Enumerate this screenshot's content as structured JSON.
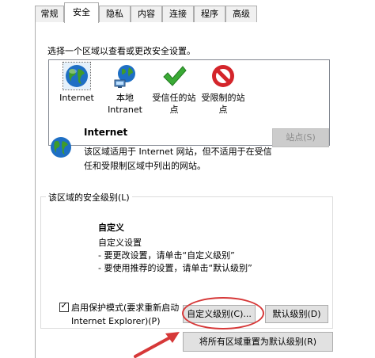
{
  "tabs": [
    {
      "label": "常规",
      "active": false
    },
    {
      "label": "安全",
      "active": true
    },
    {
      "label": "隐私",
      "active": false
    },
    {
      "label": "内容",
      "active": false
    },
    {
      "label": "连接",
      "active": false
    },
    {
      "label": "程序",
      "active": false
    },
    {
      "label": "高级",
      "active": false
    }
  ],
  "zones": {
    "prompt": "选择一个区域以查看或更改安全设置。",
    "items": [
      {
        "label": "Internet",
        "icon": "globe-icon"
      },
      {
        "label": "本地 Intranet",
        "icon": "network-globe-icon"
      },
      {
        "label": "受信任的站点",
        "icon": "checkmark-icon"
      },
      {
        "label": "受限制的站点",
        "icon": "no-entry-icon"
      }
    ]
  },
  "selected_zone": {
    "title": "Internet",
    "description": "该区域适用于 Internet 网站，但不适用于在受信任和受限制区域中列出的网站。",
    "sites_button": "站点(S)"
  },
  "security_level": {
    "group_label": "该区域的安全级别(L)",
    "title": "自定义",
    "lines": [
      "自定义设置",
      "- 要更改设置，请单击“自定义级别”",
      "- 要使用推荐的设置，请单击“默认级别”"
    ]
  },
  "protected_mode": {
    "label": "启用保护模式(要求重新启动 Internet Explorer)(P)",
    "checked": true
  },
  "buttons": {
    "custom_level": "自定义级别(C)...",
    "default_level": "默认级别(D)",
    "reset_all": "将所有区域重置为默认级别(R)"
  },
  "colors": {
    "annotation": "#d63838",
    "globe_blue": "#1e6fc4",
    "globe_green": "#3f9b2a",
    "check_green": "#3aaa35",
    "restricted_red": "#d4252b"
  }
}
